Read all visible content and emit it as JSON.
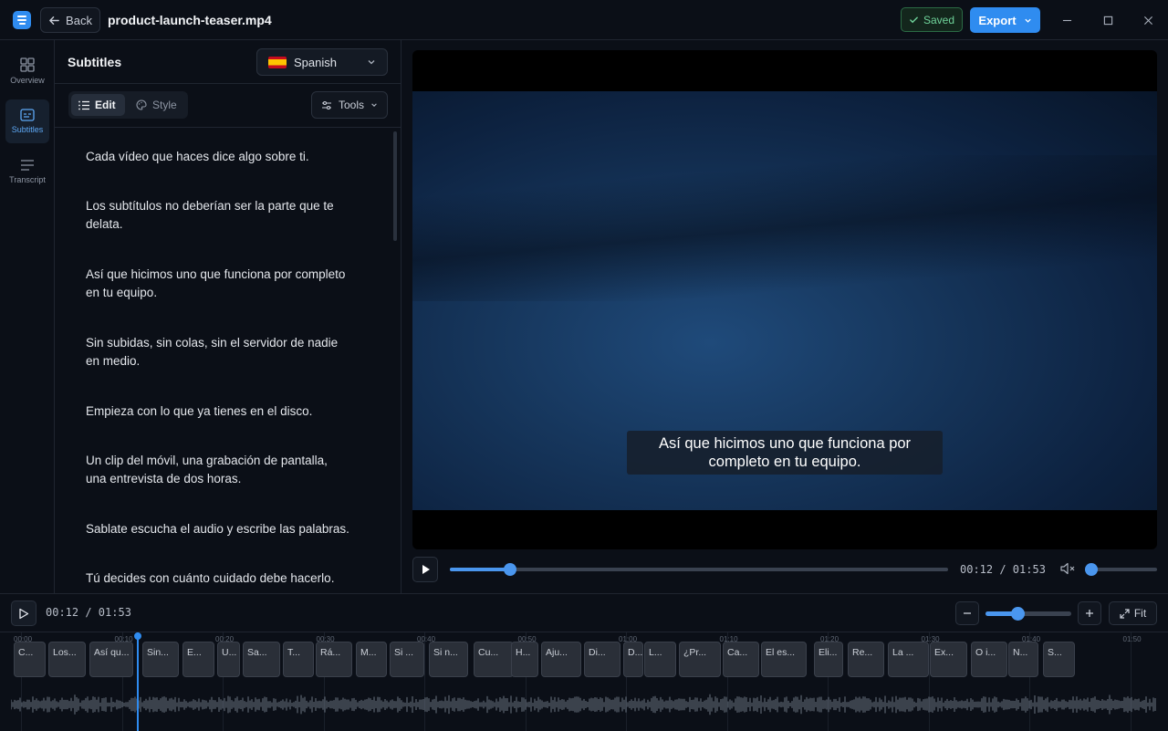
{
  "titlebar": {
    "back_label": "Back",
    "filename": "product-launch-teaser.mp4",
    "saved_label": "Saved",
    "export_label": "Export"
  },
  "rail": {
    "items": [
      {
        "label": "Overview",
        "icon": "grid-icon"
      },
      {
        "label": "Subtitles",
        "icon": "subtitles-icon"
      },
      {
        "label": "Transcript",
        "icon": "lines-icon"
      }
    ]
  },
  "subtitles_panel": {
    "title": "Subtitles",
    "language": "Spanish",
    "tabs": [
      "Edit",
      "Style"
    ],
    "tools_label": "Tools",
    "items": [
      "Cada vídeo que haces dice algo sobre ti.",
      "Los subtítulos no deberían ser la parte que te delata.",
      "Así que hicimos uno que funciona por completo en tu equipo.",
      "Sin subidas, sin colas, sin el servidor de nadie en medio.",
      "Empieza con lo que ya tienes en el disco.",
      "Un clip del móvil, una grabación de pantalla, una entrevista de dos horas.",
      "Sablate escucha el audio y escribe las palabras.",
      "Tú decides con cuánto cuidado debe hacerlo."
    ]
  },
  "player": {
    "caption_line1": "Así que hicimos uno que funciona por",
    "caption_line2": "completo en tu equipo.",
    "time": "00:12 / 01:53",
    "progress": 0.12,
    "volume": 0.0
  },
  "timeline": {
    "time": "00:12 / 01:53",
    "zoom_level": 0.37,
    "fit_label": "Fit",
    "ticks": [
      "00:00",
      "00:10",
      "00:20",
      "00:30",
      "00:40",
      "00:50",
      "01:00",
      "01:10",
      "01:20",
      "01:30",
      "01:40",
      "01:50"
    ],
    "clips": [
      "C...",
      "Los...",
      "Así qu...",
      "Sin...",
      "E...",
      "U...",
      "Sa...",
      "T...",
      "Rá...",
      "M...",
      "Si ...",
      "Si n...",
      "Cu...",
      "H...",
      "Aju...",
      "Di...",
      "D...",
      "L...",
      "¿Pr...",
      "Ca...",
      "El es...",
      "Eli...",
      "Re...",
      "La ...",
      "Ex...",
      "O i...",
      "N...",
      "S..."
    ]
  },
  "colors": {
    "accent": "#2f8cf0",
    "saved_green": "#6fd39a",
    "background": "#0b0f17"
  }
}
